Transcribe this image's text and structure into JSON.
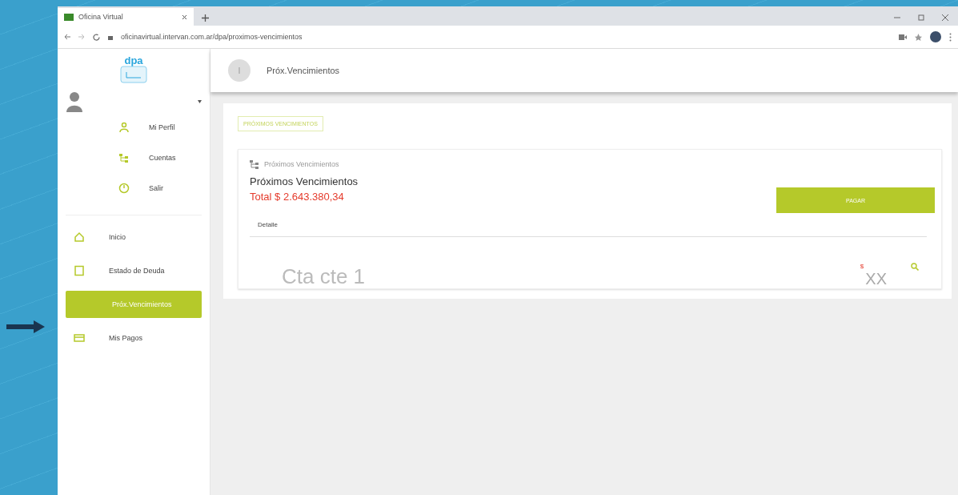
{
  "browser": {
    "tab_title": "Oficina Virtual",
    "url": "oficinavirtual.intervan.com.ar/dpa/proximos-vencimientos"
  },
  "sidebar": {
    "logo": "dpa",
    "user_menu": [
      {
        "label": "Mi Perfil",
        "kind": "person"
      },
      {
        "label": "Cuentas",
        "kind": "accounts"
      },
      {
        "label": "Salir",
        "kind": "power"
      }
    ],
    "items": [
      {
        "label": "Inicio",
        "kind": "home",
        "selected": false
      },
      {
        "label": "Estado de Deuda",
        "kind": "doc",
        "selected": false
      },
      {
        "label": "Próx.Vencimientos",
        "kind": "none",
        "selected": true
      },
      {
        "label": "Mis Pagos",
        "kind": "card",
        "selected": false
      }
    ]
  },
  "header": {
    "title": "Próx.Vencimientos"
  },
  "page": {
    "badge": "PRÓXIMOS VENCIMIENTOS",
    "card_caption": "Próximos Vencimientos",
    "card_title": "Próximos Vencimientos",
    "total": "Total $ 2.643.380,34",
    "pay_button": "PAGAR",
    "tab": "Detalle",
    "rows": [
      {
        "account": "Cta cte 1",
        "currency": "$",
        "amount": "XX"
      }
    ]
  }
}
